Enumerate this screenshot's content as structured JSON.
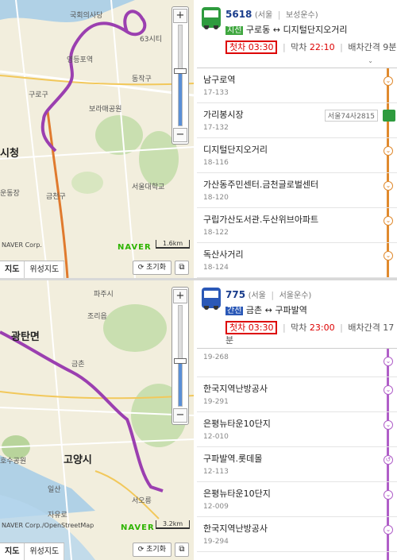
{
  "panels": [
    {
      "map": {
        "labels": [
          "국회의사당",
          "영등포역",
          "63시티",
          "동작구",
          "구로구",
          "보라매공원",
          "시청",
          "금천구",
          "서울대학교",
          "운동장",
          "NAVER Corp."
        ],
        "zoom_in": "+",
        "zoom_out": "−",
        "zoom_level_fraction": 0.55,
        "map_type_tabs": [
          "지도",
          "위성지도"
        ],
        "scale_text": "1.6km",
        "reset_label": "초기화",
        "brand": "NAVER",
        "route_color": "#9b3fb0"
      },
      "bus": {
        "number": "5618",
        "region": "(서울",
        "company": "보성운수)",
        "type_label": "지선",
        "type_color": "#3fa73f",
        "route": "구로동 ↔ 디지털단지오거리",
        "first_label": "첫차 03:30",
        "last_label": "막차",
        "last_value": "22:10",
        "interval_label": "배차간격 9분",
        "icon_color": "#2e9b3e",
        "rail_color": "#e08a2e"
      },
      "stops": [
        {
          "name": "남구로역",
          "id": "17-133"
        },
        {
          "name": "가리봉시장",
          "id": "17-132",
          "plate": "서울74사2815"
        },
        {
          "name": "디지털단지오거리",
          "id": "18-116"
        },
        {
          "name": "가산동주민센터.금천글로벌센터",
          "id": "18-120"
        },
        {
          "name": "구립가산도서관.두산위브아파트",
          "id": "18-122"
        },
        {
          "name": "독산사거리",
          "id": "18-124"
        }
      ]
    },
    {
      "map": {
        "labels": [
          "파주시",
          "광탄면",
          "조리읍",
          "금촌",
          "고양시",
          "일산",
          "자유로",
          "서오릉",
          "호수공원",
          "NAVER Corp./OpenStreetMap"
        ],
        "zoom_in": "+",
        "zoom_out": "−",
        "zoom_level_fraction": 0.45,
        "map_type_tabs": [
          "지도",
          "위성지도"
        ],
        "scale_text": "3.2km",
        "reset_label": "초기화",
        "brand": "NAVER",
        "route_color": "#9b3fb0"
      },
      "bus": {
        "number": "775",
        "region": "(서울",
        "company": "서울운수)",
        "type_label": "간선",
        "type_color": "#2a58b7",
        "route": "금촌 ↔ 구파발역",
        "first_label": "첫차 03:30",
        "last_label": "막차",
        "last_value": "23:00",
        "interval_label": "배차간격 17분",
        "icon_color": "#2a58b7",
        "rail_color": "#b05fc8"
      },
      "stops": [
        {
          "name": "",
          "id": "19-268"
        },
        {
          "name": "한국지역난방공사",
          "id": "19-291"
        },
        {
          "name": "은평뉴타운10단지",
          "id": "12-010"
        },
        {
          "name": "구파발역.롯데몰",
          "id": "12-113"
        },
        {
          "name": "은평뉴타운10단지",
          "id": "12-009"
        },
        {
          "name": "한국지역난방공사",
          "id": "19-294"
        }
      ]
    }
  ]
}
